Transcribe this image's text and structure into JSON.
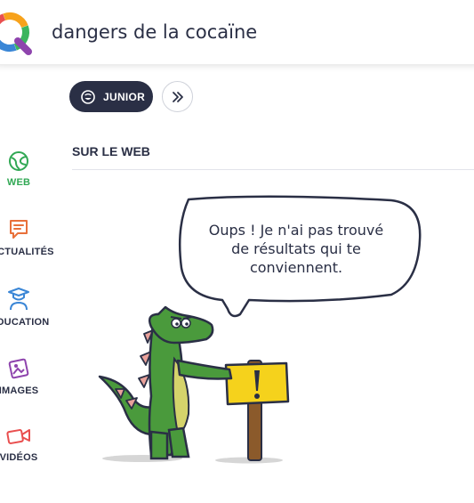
{
  "brand": {
    "stripe_colors": [
      "#e94f4f",
      "#f7a21b",
      "#f7d53a",
      "#3cb55e",
      "#3a86d6"
    ],
    "accent_active": "#31a854",
    "dark": "#2a2f45"
  },
  "search": {
    "query": "dangers de la cocaïne",
    "logo_icon": "qwant-junior-logo"
  },
  "filters": {
    "junior_label": "JUNIOR",
    "junior_icon": "smiley-icon",
    "more_icon": "chevron-double-right-icon"
  },
  "sidebar": {
    "items": [
      {
        "label": "WEB",
        "icon": "globe-icon",
        "active": true
      },
      {
        "label": "ACTUALITÉS",
        "icon": "news-icon",
        "active": false
      },
      {
        "label": "ÉDUCATION",
        "icon": "graduate-icon",
        "active": false
      },
      {
        "label": "IMAGES",
        "icon": "image-icon",
        "active": false
      },
      {
        "label": "VIDÉOS",
        "icon": "video-icon",
        "active": false
      }
    ]
  },
  "main": {
    "section_title": "SUR LE WEB",
    "empty_message": "Oups ! Je n'ai pas trouvé de résultats qui te conviennent."
  }
}
